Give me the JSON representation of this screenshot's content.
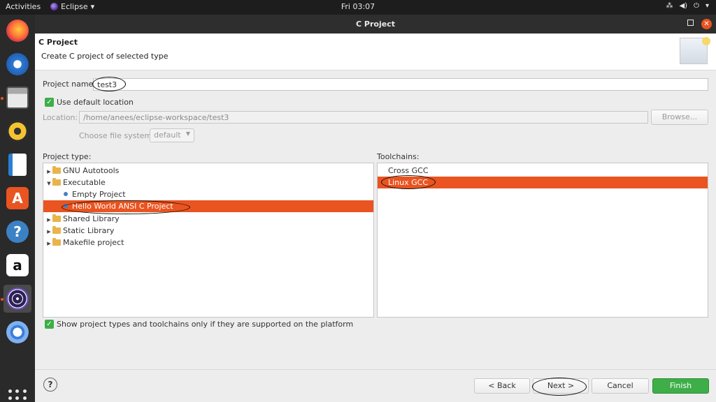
{
  "topbar": {
    "activities": "Activities",
    "app_name": "Eclipse",
    "app_menu_arrow": "▾",
    "clock": "Fri 03:07",
    "tray": {
      "network": "⁂",
      "volume": "◀)",
      "power": "⏻",
      "menu": "▾"
    }
  },
  "dock": {
    "items": [
      {
        "name": "firefox-icon"
      },
      {
        "name": "thunderbird-icon"
      },
      {
        "name": "files-icon"
      },
      {
        "name": "rhythmbox-icon"
      },
      {
        "name": "libreoffice-writer-icon"
      },
      {
        "name": "ubuntu-software-icon",
        "glyph": "A"
      },
      {
        "name": "help-icon",
        "glyph": "?"
      },
      {
        "name": "amazon-icon",
        "glyph": "a"
      },
      {
        "name": "eclipse-icon"
      },
      {
        "name": "chromium-icon"
      }
    ]
  },
  "dialog": {
    "title": "C Project",
    "close_glyph": "✕",
    "banner_title": "C Project",
    "banner_subtitle": "Create C project of selected type",
    "project_name_label": "Project name:",
    "project_name_value": "test3",
    "use_default_label": "Use default location",
    "location_label": "Location:",
    "location_value": "/home/anees/eclipse-workspace/test3",
    "browse_label": "Browse...",
    "file_system_label": "Choose file system:",
    "file_system_value": "default",
    "project_type_label": "Project type:",
    "toolchains_label": "Toolchains:",
    "project_types": [
      {
        "label": "GNU Autotools",
        "arrow": "▶",
        "kind": "folder"
      },
      {
        "label": "Executable",
        "arrow": "▼",
        "kind": "folder"
      },
      {
        "label": "Empty Project",
        "kind": "item"
      },
      {
        "label": "Hello World ANSI C Project",
        "kind": "item",
        "selected": true
      },
      {
        "label": "Shared Library",
        "arrow": "▶",
        "kind": "folder"
      },
      {
        "label": "Static Library",
        "arrow": "▶",
        "kind": "folder"
      },
      {
        "label": "Makefile project",
        "arrow": "▶",
        "kind": "folder"
      }
    ],
    "toolchains": [
      {
        "label": "Cross GCC"
      },
      {
        "label": "Linux GCC",
        "selected": true
      }
    ],
    "show_supported_label": "Show project types and toolchains only if they are supported on the platform",
    "check_glyph": "✓",
    "help_glyph": "?",
    "buttons": {
      "back": "< Back",
      "next": "Next >",
      "cancel": "Cancel",
      "finish": "Finish"
    }
  },
  "colors": {
    "accent": "#e95420",
    "finish": "#3eae49",
    "checkbox": "#3eae49"
  }
}
